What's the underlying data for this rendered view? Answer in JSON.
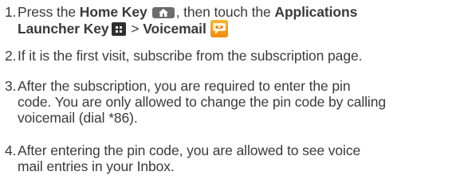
{
  "steps": [
    {
      "number": "1.",
      "parts": {
        "a": "Press the ",
        "home_key": "Home Key",
        "b": ", then touch the ",
        "apps_key": "Applications",
        "apps_key_2": "Launcher Key",
        "c": " > ",
        "voicemail": "Voicemail"
      },
      "icons": [
        "home-key-icon",
        "applications-launcher-icon",
        "voicemail-app-icon"
      ]
    },
    {
      "number": "2.",
      "lines": [
        "If it is the first visit, subscribe from the subscription page."
      ]
    },
    {
      "number": "3.",
      "lines": [
        "After the subscription, you are required to enter the pin",
        "code. You are only allowed to change the pin code by calling",
        "voicemail (dial *86)."
      ]
    },
    {
      "number": "4.",
      "lines": [
        "After entering the pin code, you are allowed to see voice",
        "mail entries in your Inbox."
      ]
    }
  ],
  "colors": {
    "text": "#3a3a3a",
    "home_key_bg": "#6b6b6b",
    "apps_key_bg": "#2f2f2f",
    "voicemail_icon": "#f39c1a"
  }
}
